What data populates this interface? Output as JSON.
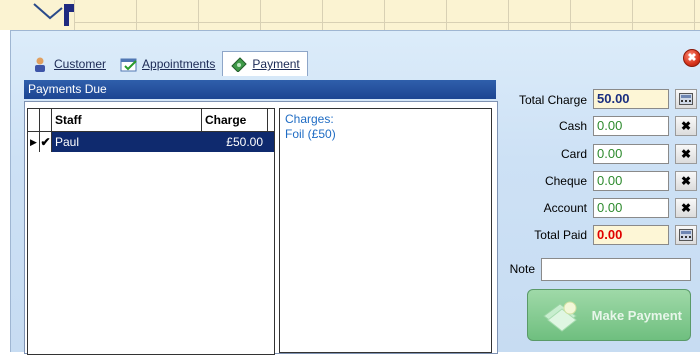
{
  "tabs": [
    {
      "label": "Customer",
      "icon": "customer-icon",
      "active": false
    },
    {
      "label": "Appointments",
      "icon": "appointments-icon",
      "active": false
    },
    {
      "label": "Payment",
      "icon": "payment-icon",
      "active": true
    }
  ],
  "payments_due": {
    "header": "Payments Due",
    "columns": {
      "staff": "Staff",
      "charge": "Charge"
    },
    "rows": [
      {
        "indicator": "▶",
        "checked": "✔",
        "staff": "Paul",
        "charge": "£50.00"
      }
    ],
    "charges_title": "Charges:",
    "charges_items": [
      "Foil (£50)"
    ]
  },
  "payment": {
    "total_charge": {
      "label": "Total Charge",
      "value": "50.00",
      "color": "#1a2e80"
    },
    "cash": {
      "label": "Cash",
      "value": "0.00",
      "color": "#2e8b2e"
    },
    "card": {
      "label": "Card",
      "value": "0.00",
      "color": "#2e8b2e"
    },
    "cheque": {
      "label": "Cheque",
      "value": "0.00",
      "color": "#2e8b2e"
    },
    "account": {
      "label": "Account",
      "value": "0.00",
      "color": "#2e8b2e"
    },
    "total_paid": {
      "label": "Total Paid",
      "value": "0.00",
      "color": "#e00000"
    },
    "note_label": "Note",
    "note_value": "",
    "clear_glyph": "✖",
    "make_payment_label": "Make Payment"
  },
  "close_glyph": "✖"
}
